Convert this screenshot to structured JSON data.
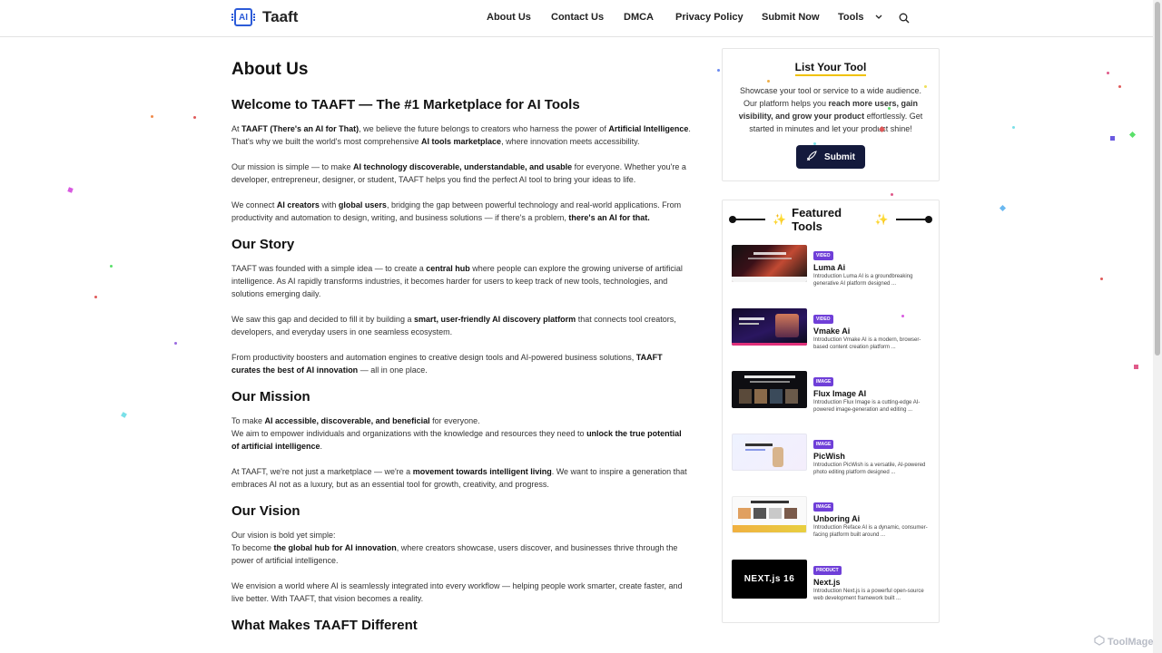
{
  "header": {
    "brand": "Taaft",
    "logo_text": "AI",
    "nav": [
      {
        "label": "About Us"
      },
      {
        "label": "Contact Us"
      },
      {
        "label": "DMCA"
      },
      {
        "label": "Privacy Policy"
      },
      {
        "label": "Submit Now"
      },
      {
        "label": "Tools"
      }
    ],
    "icons": {
      "tools_dropdown": "chevron-down-icon",
      "search": "search-icon"
    }
  },
  "main": {
    "title": "About Us",
    "welcome": {
      "heading": "Welcome to TAAFT — The #1 Marketplace for AI Tools",
      "p1": {
        "a": "At ",
        "b": "TAAFT (There's an AI for That)",
        "c": ", we believe the future belongs to creators who harness the power of ",
        "d": "Artificial Intelligence",
        "e": ". That's why we built the world's most comprehensive ",
        "f": "AI tools marketplace",
        "g": ", where innovation meets accessibility."
      },
      "p2": {
        "a": "Our mission is simple — to make ",
        "b": "AI technology discoverable, understandable, and usable",
        "c": " for everyone. Whether you're a developer, entrepreneur, designer, or student, TAAFT helps you find the perfect AI tool to bring your ideas to life."
      },
      "p3": {
        "a": "We connect ",
        "b": "AI creators",
        "c": " with ",
        "d": "global users",
        "e": ", bridging the gap between powerful technology and real-world applications. From productivity and automation to design, writing, and business solutions — if there's a problem, ",
        "f": "there's an AI for that."
      }
    },
    "story": {
      "heading": "Our Story",
      "p1": {
        "a": "TAAFT was founded with a simple idea — to create a ",
        "b": "central hub",
        "c": " where people can explore the growing universe of artificial intelligence. As AI rapidly transforms industries, it becomes harder for users to keep track of new tools, technologies, and solutions emerging daily."
      },
      "p2": {
        "a": "We saw this gap and decided to fill it by building a ",
        "b": "smart, user-friendly AI discovery platform",
        "c": " that connects tool creators, developers, and everyday users in one seamless ecosystem."
      },
      "p3": {
        "a": "From productivity boosters and automation engines to creative design tools and AI-powered business solutions, ",
        "b": "TAAFT curates the best of AI innovation",
        "c": " — all in one place."
      }
    },
    "mission": {
      "heading": "Our Mission",
      "p1": {
        "a": "To make ",
        "b": "AI accessible, discoverable, and beneficial",
        "c": " for everyone.",
        "d": "We aim to empower individuals and organizations with the knowledge and resources they need to ",
        "e": "unlock the true potential of artificial intelligence",
        "f": "."
      },
      "p2": {
        "a": "At TAAFT, we're not just a marketplace — we're a ",
        "b": "movement towards intelligent living",
        "c": ". We want to inspire a generation that embraces AI not as a luxury, but as an essential tool for growth, creativity, and progress."
      }
    },
    "vision": {
      "heading": "Our Vision",
      "p1": {
        "a": "Our vision is bold yet simple:",
        "b": "To become ",
        "c": "the global hub for AI innovation",
        "d": ", where creators showcase, users discover, and businesses thrive through the power of artificial intelligence."
      },
      "p2": "We envision a world where AI is seamlessly integrated into every workflow — helping people work smarter, create faster, and live better. With TAAFT, that vision becomes a reality."
    },
    "different_heading": "What Makes TAAFT Different"
  },
  "sidebar": {
    "list": {
      "title": "List Your Tool",
      "text": {
        "a": "Showcase your tool or service to a wide audience. Our platform helps you ",
        "b": "reach more users, gain visibility, and grow your product",
        "c": " effortlessly. Get started in minutes and let your product shine!"
      },
      "submit_label": "Submit",
      "submit_icon": "rocket-icon"
    },
    "featured": {
      "title": "Featured Tools",
      "tools": [
        {
          "badge": "Video",
          "name": "Luma Ai",
          "desc": "Introduction Luma AI is a groundbreaking generative AI platform designed ..."
        },
        {
          "badge": "Video",
          "name": "Vmake Ai",
          "desc": "Introduction Vmake AI is a modern, browser-based content creation platform ..."
        },
        {
          "badge": "Image",
          "name": "Flux Image AI",
          "desc": "Introduction Flux Image is a cutting-edge AI-powered image-generation and editing ..."
        },
        {
          "badge": "Image",
          "name": "PicWish",
          "desc": "Introduction PicWish is a versatile, AI-powered photo editing platform designed ..."
        },
        {
          "badge": "Image",
          "name": "Unboring Ai",
          "desc": "Introduction Reface AI is a dynamic, consumer-facing platform built around ..."
        },
        {
          "badge": "Product",
          "name": "Next.js",
          "desc": "Introduction Next.js is a powerful open-source web development framework built ...",
          "thumb_text": "NEXT.js 16"
        }
      ]
    }
  },
  "watermark": "ToolMage"
}
